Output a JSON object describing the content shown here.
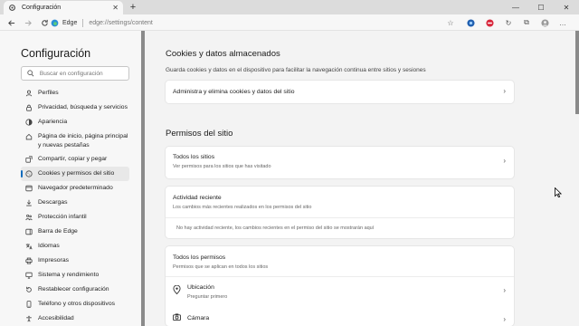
{
  "browser": {
    "tab_title": "Configuración",
    "tab_close": "✕",
    "new_tab": "+",
    "window_controls": {
      "minimize": "—",
      "maximize": "☐",
      "close": "✕"
    },
    "address_host": "Edge",
    "address_path": "edge://settings/content"
  },
  "sidebar": {
    "title": "Configuración",
    "search_placeholder": "Buscar en configuración",
    "items": [
      {
        "label": "Perfiles",
        "icon": "profile-icon"
      },
      {
        "label": "Privacidad, búsqueda y servicios",
        "icon": "lock-icon"
      },
      {
        "label": "Apariencia",
        "icon": "appearance-icon"
      },
      {
        "label": "Página de inicio, página principal y nuevas pestañas",
        "icon": "home-icon"
      },
      {
        "label": "Compartir, copiar y pegar",
        "icon": "share-icon"
      },
      {
        "label": "Cookies y permisos del sitio",
        "icon": "cookie-icon",
        "active": true
      },
      {
        "label": "Navegador predeterminado",
        "icon": "browser-icon"
      },
      {
        "label": "Descargas",
        "icon": "download-icon"
      },
      {
        "label": "Protección infantil",
        "icon": "family-icon"
      },
      {
        "label": "Barra de Edge",
        "icon": "edge-bar-icon"
      },
      {
        "label": "Idiomas",
        "icon": "language-icon"
      },
      {
        "label": "Impresoras",
        "icon": "printer-icon"
      },
      {
        "label": "Sistema y rendimiento",
        "icon": "system-icon"
      },
      {
        "label": "Restablecer configuración",
        "icon": "reset-icon"
      },
      {
        "label": "Teléfono y otros dispositivos",
        "icon": "phone-icon"
      },
      {
        "label": "Accesibilidad",
        "icon": "accessibility-icon"
      }
    ]
  },
  "main": {
    "cookies": {
      "heading": "Cookies y datos almacenados",
      "description": "Guarda cookies y datos en el dispositivo para facilitar la navegación continua entre sitios y sesiones",
      "manage_label": "Administra y elimina cookies y datos del sitio"
    },
    "permissions": {
      "heading": "Permisos del sitio",
      "all_sites_title": "Todos los sitios",
      "all_sites_desc": "Ver permisos para los sitios que has visitado",
      "recent_title": "Actividad reciente",
      "recent_desc": "Los cambios más recientes realizados en los permisos del sitio",
      "recent_empty": "No hay actividad reciente, los cambios recientes en el permiso del sitio se mostrarán aquí",
      "all_perms_title": "Todos los permisos",
      "all_perms_desc": "Permisos que se aplican en todos los sitios",
      "location_title": "Ubicación",
      "location_desc": "Preguntar primero",
      "camera_title": "Cámara"
    },
    "chevron": "›"
  },
  "colors": {
    "accent": "#0f6cbd",
    "background": "#f3f3f3",
    "card": "#ffffff"
  }
}
